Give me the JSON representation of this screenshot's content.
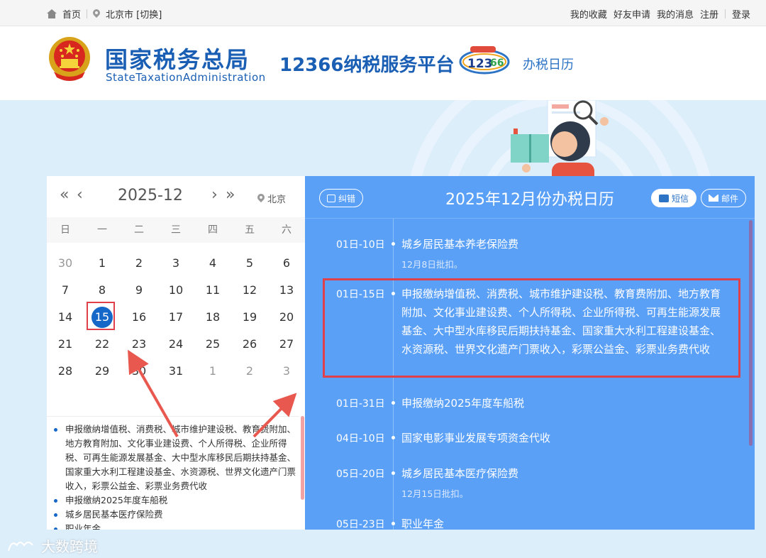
{
  "topbar": {
    "home": "首页",
    "city": "北京市 [切换]",
    "links": [
      "我的收藏",
      "好友申请",
      "我的消息",
      "注册",
      "登录"
    ]
  },
  "header": {
    "brand_cn": "国家税务总局",
    "brand_en": "StateTaxationAdministration",
    "platform": "12366纳税服务平台",
    "subtitle": "办税日历"
  },
  "calendar": {
    "month": "2025-12",
    "city": "北京",
    "weekdays": [
      "日",
      "一",
      "二",
      "三",
      "四",
      "五",
      "六"
    ],
    "weeks": [
      [
        "30",
        "1",
        "2",
        "3",
        "4",
        "5",
        "6"
      ],
      [
        "7",
        "8",
        "9",
        "10",
        "11",
        "12",
        "13"
      ],
      [
        "14",
        "15",
        "16",
        "17",
        "18",
        "19",
        "20"
      ],
      [
        "21",
        "22",
        "23",
        "24",
        "25",
        "26",
        "27"
      ],
      [
        "28",
        "29",
        "30",
        "31",
        "1",
        "2",
        "3"
      ]
    ],
    "today": "15",
    "list": [
      "申报缴纳增值税、消费税、城市维护建设税、教育费附加、地方教育附加、文化事业建设费、个人所得税、企业所得税、可再生能源发展基金、大中型水库移民后期扶持基金、国家重大水利工程建设基金、水资源税、世界文化遗产门票收入，彩票公益金、彩票业务费代收",
      "申报缴纳2025年度车船税",
      "城乡居民基本医疗保险费",
      "职业年金"
    ]
  },
  "panel": {
    "title": "2025年12月份办税日历",
    "correct_btn": "纠错",
    "sms_btn": "短信",
    "mail_btn": "邮件",
    "entries": [
      {
        "date": "01日-10日",
        "item": "城乡居民基本养老保险费",
        "note": "12月8日批扣。"
      },
      {
        "date": "01日-15日",
        "item": "申报缴纳增值税、消费税、城市维护建设税、教育费附加、地方教育附加、文化事业建设费、个人所得税、企业所得税、可再生能源发展基金、大中型水库移民后期扶持基金、国家重大水利工程建设基金、水资源税、世界文化遗产门票收入，彩票公益金、彩票业务费代收",
        "note": ""
      },
      {
        "date": "01日-31日",
        "item": "申报缴纳2025年度车船税",
        "note": ""
      },
      {
        "date": "04日-10日",
        "item": "国家电影事业发展专项资金代收",
        "note": ""
      },
      {
        "date": "05日-20日",
        "item": "城乡居民基本医疗保险费",
        "note": "12月15日批扣。"
      },
      {
        "date": "05日-23日",
        "item": "职业年金",
        "note": ""
      }
    ]
  },
  "watermark": "大数跨境",
  "colors": {
    "brand_blue": "#1a5fb4",
    "panel_blue": "#5aa0f7",
    "today_blue": "#1568c7",
    "highlight_red": "#e0404a"
  }
}
